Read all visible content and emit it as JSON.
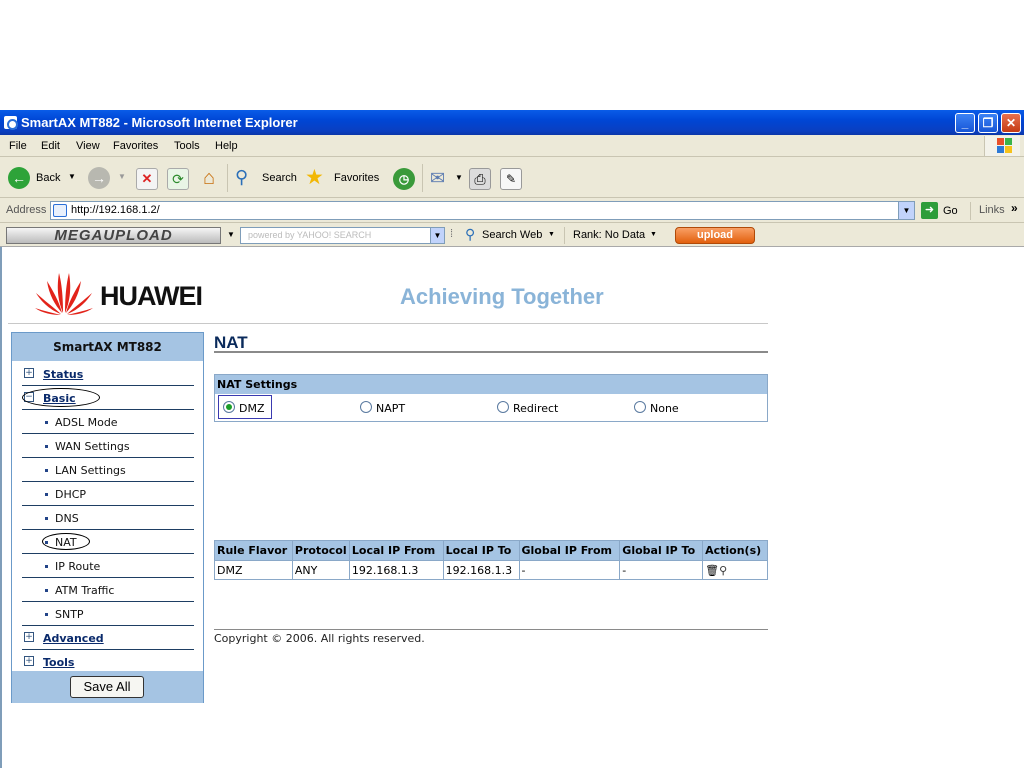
{
  "window": {
    "title": "SmartAX MT882 - Microsoft Internet Explorer",
    "controls": [
      "minimize",
      "restore",
      "close"
    ]
  },
  "menubar": [
    "File",
    "Edit",
    "View",
    "Favorites",
    "Tools",
    "Help"
  ],
  "toolbar": {
    "back_label": "Back",
    "search_label": "Search",
    "favorites_label": "Favorites"
  },
  "addressbar": {
    "label": "Address",
    "url": "http://192.168.1.2/",
    "go_label": "Go",
    "links_label": "Links"
  },
  "megabar": {
    "logo_text": "MEGAUPLOAD",
    "search_placeholder": "powered by YAHOO! SEARCH",
    "search_web_label": "Search Web",
    "rank_label": "Rank: No Data",
    "upload_label": "upload"
  },
  "page": {
    "brand": "HUAWEI",
    "tagline": "Achieving Together",
    "sidebar": {
      "title": "SmartAX MT882",
      "items": [
        {
          "label": "Status"
        },
        {
          "label": "Basic"
        },
        {
          "label": "ADSL Mode"
        },
        {
          "label": "WAN Settings"
        },
        {
          "label": "LAN Settings"
        },
        {
          "label": "DHCP"
        },
        {
          "label": "DNS"
        },
        {
          "label": "NAT"
        },
        {
          "label": "IP Route"
        },
        {
          "label": "ATM Traffic"
        },
        {
          "label": "SNTP"
        },
        {
          "label": "Advanced"
        },
        {
          "label": "Tools"
        }
      ],
      "save_all_label": "Save All"
    },
    "main": {
      "title": "NAT",
      "nat_settings": {
        "heading": "NAT Settings",
        "options": [
          "DMZ",
          "NAPT",
          "Redirect",
          "None"
        ],
        "selected": "DMZ"
      },
      "rules_table": {
        "columns": [
          "Rule Flavor",
          "Protocol",
          "Local IP From",
          "Local IP To",
          "Global IP From",
          "Global IP To",
          "Action(s)"
        ],
        "rows": [
          [
            "DMZ",
            "ANY",
            "192.168.1.3",
            "192.168.1.3",
            "-",
            "-",
            ""
          ]
        ]
      },
      "copyright": "Copyright © 2006. All rights reserved."
    }
  },
  "colors": {
    "titlebar": "#0a5ce8",
    "panel_header": "#a5c4e3",
    "tagline": "#8ab4d8",
    "brand_red": "#e2231a"
  }
}
